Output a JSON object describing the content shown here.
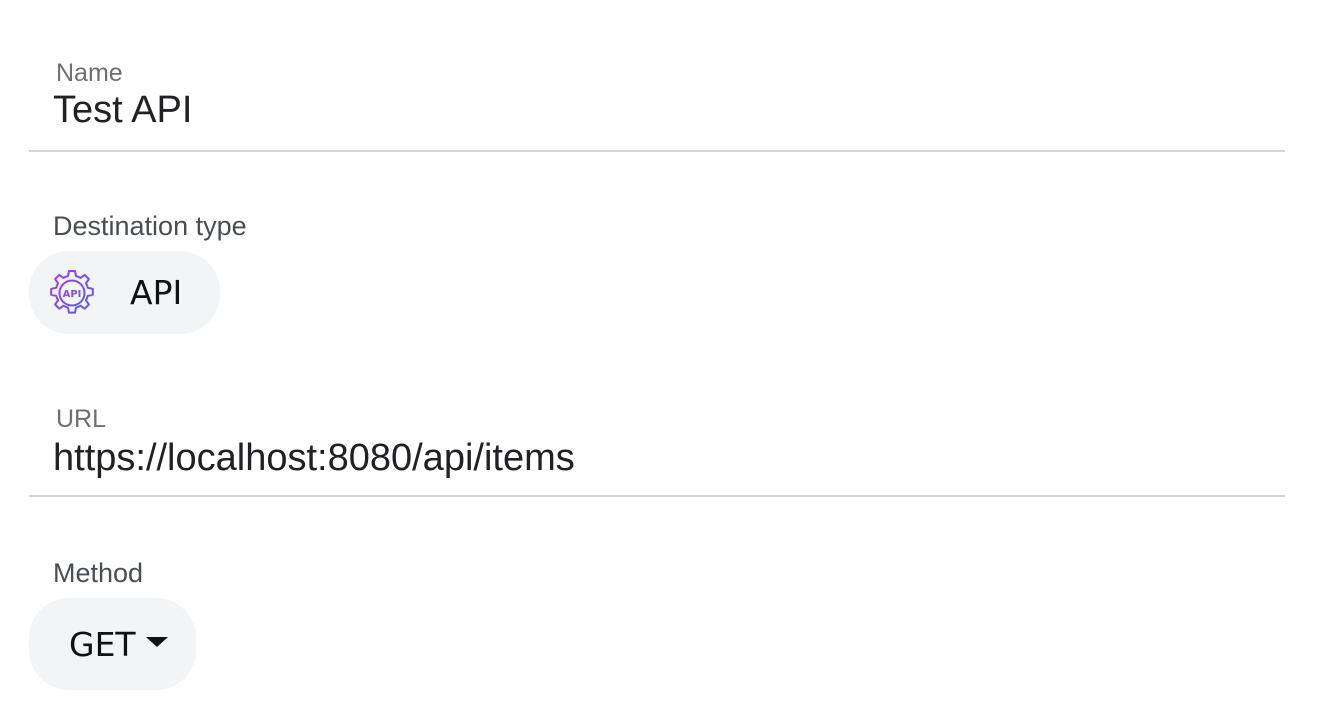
{
  "name_field": {
    "label": "Name",
    "value": "Test API"
  },
  "destination_type": {
    "label": "Destination type",
    "selected": "API",
    "icon": "api-gear-icon",
    "icon_text": "API"
  },
  "url_field": {
    "label": "URL",
    "value": "https://localhost:8080/api/items"
  },
  "method": {
    "label": "Method",
    "selected": "GET"
  },
  "colors": {
    "icon_gradient_start": "#9b3ff0",
    "icon_gradient_end": "#5b5cf0"
  }
}
